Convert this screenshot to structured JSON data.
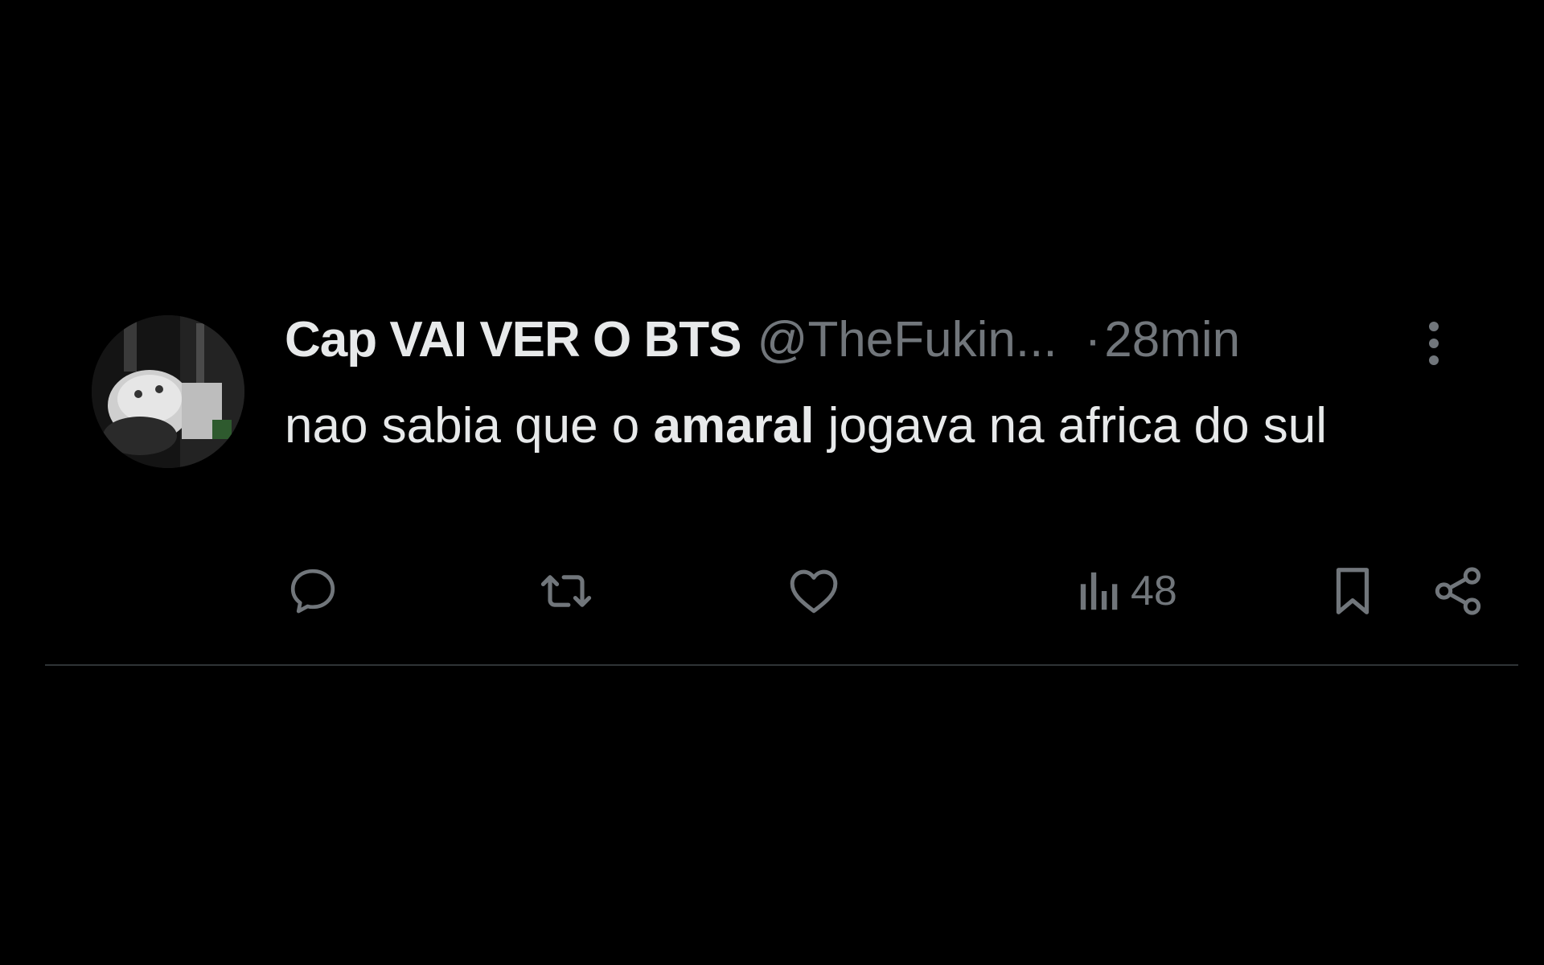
{
  "tweet": {
    "author": {
      "display_name": "Cap VAI VER O BTS",
      "handle": "@TheFukin...",
      "avatar_icon": "profile-photo"
    },
    "separator": "·",
    "time": "28min",
    "text_before": "nao sabia que o ",
    "text_bold": "amaral",
    "text_after": " jogava na africa do sul",
    "metrics": {
      "views": "48"
    }
  },
  "icons": {
    "reply": "reply-icon",
    "retweet": "retweet-icon",
    "like": "like-icon",
    "views": "views-icon",
    "bookmark": "bookmark-icon",
    "share": "share-icon",
    "more": "more-options-icon"
  },
  "colors": {
    "background": "#000000",
    "primary_text": "#e7e9ea",
    "secondary_text": "#71767b",
    "divider": "#2f3336"
  }
}
